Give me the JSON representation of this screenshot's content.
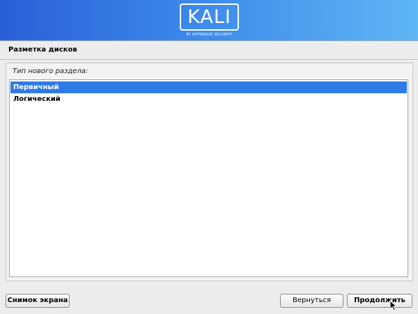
{
  "banner": {
    "logo_text": "KALI",
    "logo_subtitle": "BY OFFENSIVE SECURITY",
    "background": "#3b88ea"
  },
  "page": {
    "title": "Разметка дисков"
  },
  "form": {
    "question": "Тип нового раздела:",
    "options": [
      {
        "label": "Первичный",
        "selected": true
      },
      {
        "label": "Логический",
        "selected": false
      }
    ],
    "selection_color": "#2f7be6"
  },
  "buttons": {
    "screenshot": "Снимок экрана",
    "back": "Вернуться",
    "continue": "Продолжить"
  }
}
